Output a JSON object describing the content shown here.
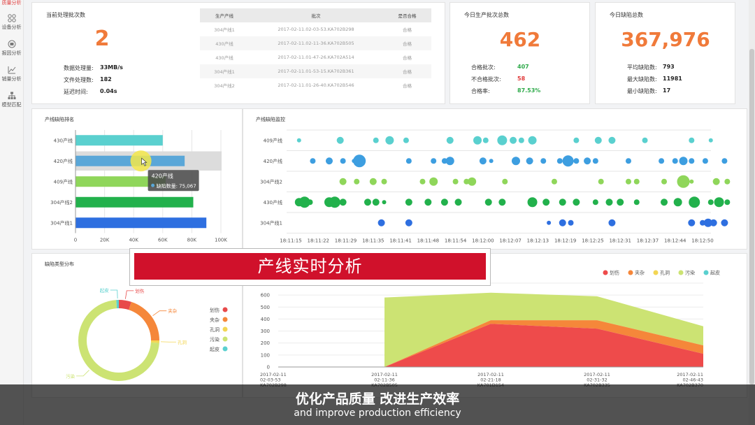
{
  "sidebar": {
    "top_label": "质量分析",
    "items": [
      {
        "label": "设备分析",
        "icon": "grid-icon"
      },
      {
        "label": "报因分析",
        "icon": "target-icon"
      },
      {
        "label": "销量分析",
        "icon": "line-chart-icon"
      },
      {
        "label": "模型匹配",
        "icon": "hierarchy-icon"
      }
    ]
  },
  "processing": {
    "title": "当前处理批次数",
    "value": "2",
    "stats": [
      {
        "label": "数据处理量:",
        "value": "33MB/s"
      },
      {
        "label": "文件处理数:",
        "value": "182"
      },
      {
        "label": "延迟时间:",
        "value": "0.04s"
      }
    ]
  },
  "batch_table": {
    "headers": [
      "生产产线",
      "批次",
      "是否合格"
    ],
    "rows": [
      [
        "304产线1",
        "2017-02-11.02-03-53.KA702B298",
        "合格"
      ],
      [
        "430产线",
        "2017-02-11.02-11-36.KA702B505",
        "合格"
      ],
      [
        "430产线",
        "2017-02-11.01-47-26.KA702A514",
        "合格"
      ],
      [
        "304产线1",
        "2017-02-11.01-53-15.KA702B361",
        "合格"
      ],
      [
        "304产线2",
        "2017-02-11.01-26-40.KA702B546",
        "合格"
      ]
    ]
  },
  "today_batches": {
    "title": "今日生产批次总数",
    "value": "462",
    "stats": [
      {
        "label": "合格批次:",
        "value": "407",
        "color": "#2eaa4a"
      },
      {
        "label": "不合格批次:",
        "value": "58",
        "color": "#e03a3a"
      },
      {
        "label": "合格率:",
        "value": "87.53%",
        "color": "#2eaa4a"
      }
    ]
  },
  "today_defects": {
    "title": "今日缺陷总数",
    "value": "367,976",
    "stats": [
      {
        "label": "平均缺陷数:",
        "value": "793"
      },
      {
        "label": "最大缺陷数:",
        "value": "11981"
      },
      {
        "label": "最小缺陷数:",
        "value": "17"
      }
    ]
  },
  "chart_data": [
    {
      "type": "bar",
      "title": "产线缺陷排名",
      "orientation": "horizontal",
      "categories": [
        "430产线",
        "420产线",
        "409产线",
        "304产线2",
        "304产线1"
      ],
      "values": [
        60000,
        75067,
        62000,
        81000,
        90000
      ],
      "colors": [
        "#5ad0cf",
        "#5aa7d8",
        "#8fd65a",
        "#22b14c",
        "#2e6fe0"
      ],
      "xlim": [
        0,
        100000
      ],
      "xticks": [
        "0",
        "20K",
        "40K",
        "60K",
        "80K",
        "100K"
      ],
      "tooltip": {
        "title": "420产线",
        "label": "缺陷数量",
        "value": "75,067"
      }
    },
    {
      "type": "scatter",
      "title": "产线缺陷监控",
      "categories": [
        "409产线",
        "420产线",
        "304产线2",
        "430产线",
        "304产线1"
      ],
      "colors": [
        "#5ad0cf",
        "#3d9ee0",
        "#8fd65a",
        "#22b14c",
        "#2e6fe0"
      ],
      "xticks": [
        "18:11:15",
        "18:11:22",
        "18:11:29",
        "18:11:35",
        "18:11:41",
        "18:11:48",
        "18:11:54",
        "18:12:00",
        "18:12:07",
        "18:12:13",
        "18:12:19",
        "18:12:25",
        "18:12:31",
        "18:12:37",
        "18:12:44",
        "18:12:50"
      ],
      "series": [
        {
          "row": 0,
          "points": [
            [
              0.3,
              3
            ],
            [
              1.8,
              5
            ],
            [
              3.1,
              4
            ],
            [
              3.6,
              6
            ],
            [
              4.2,
              4
            ],
            [
              5.8,
              5
            ],
            [
              6.8,
              6
            ],
            [
              7.1,
              4
            ],
            [
              7.7,
              7
            ],
            [
              8.1,
              5
            ],
            [
              8.4,
              4
            ],
            [
              8.8,
              6
            ],
            [
              10.4,
              4
            ],
            [
              11.2,
              5
            ],
            [
              11.7,
              5
            ],
            [
              12.9,
              4
            ],
            [
              14.6,
              4
            ],
            [
              15.3,
              3
            ]
          ]
        },
        {
          "row": 1,
          "points": [
            [
              0.8,
              4
            ],
            [
              1.4,
              5
            ],
            [
              1.9,
              4
            ],
            [
              2.3,
              3
            ],
            [
              2.5,
              9
            ],
            [
              4.3,
              4
            ],
            [
              5.2,
              4
            ],
            [
              5.6,
              4
            ],
            [
              5.8,
              6
            ],
            [
              7.0,
              5
            ],
            [
              7.3,
              3
            ],
            [
              8.2,
              6
            ],
            [
              8.7,
              5
            ],
            [
              9.2,
              4
            ],
            [
              9.8,
              4
            ],
            [
              10.1,
              8
            ],
            [
              10.4,
              4
            ],
            [
              10.8,
              5
            ],
            [
              11.1,
              4
            ],
            [
              12.3,
              4
            ],
            [
              13.5,
              4
            ],
            [
              14.0,
              4
            ],
            [
              14.3,
              6
            ],
            [
              14.6,
              4
            ],
            [
              15.1,
              4
            ],
            [
              15.8,
              4
            ]
          ]
        },
        {
          "row": 2,
          "points": [
            [
              1.9,
              5
            ],
            [
              2.4,
              4
            ],
            [
              3.0,
              5
            ],
            [
              3.4,
              4
            ],
            [
              4.8,
              4
            ],
            [
              5.2,
              6
            ],
            [
              6.0,
              4
            ],
            [
              6.4,
              4
            ],
            [
              6.6,
              6
            ],
            [
              7.8,
              4
            ],
            [
              9.6,
              4
            ],
            [
              11.3,
              4
            ],
            [
              12.3,
              4
            ],
            [
              12.6,
              4
            ],
            [
              13.6,
              4
            ],
            [
              14.3,
              9
            ],
            [
              14.6,
              3
            ],
            [
              15.5,
              5
            ],
            [
              15.9,
              4
            ]
          ]
        },
        {
          "row": 3,
          "points": [
            [
              0.3,
              6
            ],
            [
              0.5,
              8
            ],
            [
              0.7,
              4
            ],
            [
              1.4,
              7
            ],
            [
              1.6,
              8
            ],
            [
              1.9,
              5
            ],
            [
              2.8,
              5
            ],
            [
              3.1,
              5
            ],
            [
              3.4,
              3
            ],
            [
              4.3,
              5
            ],
            [
              5.0,
              5
            ],
            [
              5.6,
              5
            ],
            [
              6.1,
              5
            ],
            [
              7.2,
              5
            ],
            [
              7.7,
              5
            ],
            [
              8.8,
              7
            ],
            [
              9.3,
              5
            ],
            [
              9.9,
              5
            ],
            [
              10.4,
              5
            ],
            [
              11.1,
              4
            ],
            [
              11.6,
              5
            ],
            [
              12.0,
              5
            ],
            [
              12.6,
              4
            ],
            [
              13.6,
              5
            ],
            [
              14.1,
              6
            ],
            [
              14.7,
              8
            ],
            [
              15.3,
              4
            ],
            [
              15.6,
              7
            ],
            [
              15.9,
              4
            ]
          ]
        },
        {
          "row": 4,
          "points": [
            [
              3.3,
              5
            ],
            [
              4.3,
              5
            ],
            [
              9.4,
              3
            ],
            [
              9.9,
              5
            ],
            [
              10.2,
              4
            ],
            [
              11.7,
              5
            ],
            [
              14.6,
              5
            ],
            [
              15.0,
              4
            ],
            [
              15.2,
              6
            ],
            [
              15.4,
              5
            ],
            [
              15.8,
              5
            ]
          ]
        }
      ]
    },
    {
      "type": "pie",
      "title": "缺陷类型分布",
      "labels": [
        "划伤",
        "夹杂",
        "孔洞",
        "污染",
        "起皮"
      ],
      "values": [
        5,
        20,
        1,
        73,
        1
      ],
      "colors": [
        "#e84a4a",
        "#f5873a",
        "#f3d654",
        "#cce373",
        "#5ad0cf"
      ]
    },
    {
      "type": "area",
      "legend": [
        "划伤",
        "夹杂",
        "孔洞",
        "污染",
        "起皮"
      ],
      "colors": [
        "#ee4b4b",
        "#f5873a",
        "#f3d654",
        "#cce373",
        "#5ad0cf"
      ],
      "ylim": [
        0,
        700
      ],
      "yticks": [
        0,
        100,
        200,
        300,
        400,
        500,
        600,
        700
      ],
      "xlabels": [
        [
          "2017-02-11",
          "02-03-53",
          "KA702B298"
        ],
        [
          "2017-02-11",
          "02-11-36",
          "KA702B505"
        ],
        [
          "2017-02-11",
          "02-21-18",
          "KA701D154"
        ],
        [
          "2017-02-11",
          "02-31-32",
          "KA702B335"
        ],
        [
          "2017-02-11",
          "02-46-43",
          "KA702B370"
        ]
      ],
      "series": [
        {
          "name": "划伤",
          "values": [
            0,
            0,
            360,
            320,
            110
          ]
        },
        {
          "name": "夹杂",
          "values": [
            0,
            0,
            30,
            70,
            70
          ]
        },
        {
          "name": "污染",
          "values": [
            0,
            580,
            230,
            200,
            160
          ]
        }
      ]
    }
  ],
  "banner": {
    "text": "产线实时分析"
  },
  "subtitle": {
    "cn": "优化产品质量 改进生产效率",
    "en": "and improve production efficiency"
  }
}
